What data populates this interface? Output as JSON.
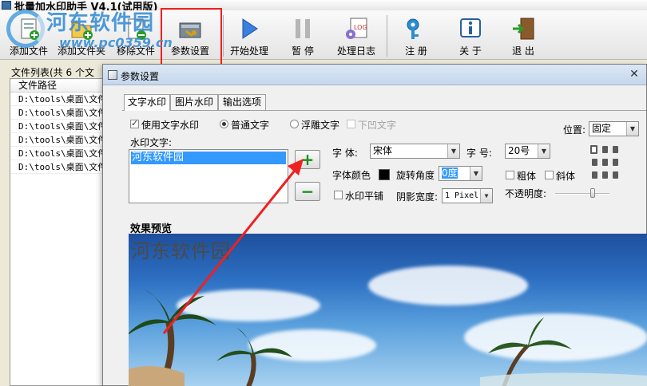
{
  "window": {
    "title": "批量加水印助手 V4.1(试用版)"
  },
  "watermark_logo": {
    "title": "河东软件园",
    "url": "www.pc0359.cn"
  },
  "toolbar": [
    {
      "key": "add_file",
      "label": "添加文件",
      "icon": "add-file-icon"
    },
    {
      "key": "add_folder",
      "label": "添加文件夹",
      "icon": "add-folder-icon"
    },
    {
      "key": "remove_file",
      "label": "移除文件",
      "icon": "remove-file-icon"
    },
    {
      "key": "settings",
      "label": "参数设置",
      "icon": "settings-icon"
    },
    {
      "key": "start",
      "label": "开始处理",
      "icon": "play-icon"
    },
    {
      "key": "pause",
      "label": "暂 停",
      "icon": "pause-icon"
    },
    {
      "key": "log",
      "label": "处理日志",
      "icon": "log-icon"
    },
    {
      "key": "register",
      "label": "注 册",
      "icon": "key-icon"
    },
    {
      "key": "about",
      "label": "关 于",
      "icon": "info-icon"
    },
    {
      "key": "exit",
      "label": "退 出",
      "icon": "exit-door-icon"
    }
  ],
  "file_panel": {
    "group_title": "文件列表(共 6 个文",
    "column_header": "文件路径",
    "rows": [
      "D:\\tools\\桌面\\文件",
      "D:\\tools\\桌面\\文件",
      "D:\\tools\\桌面\\文件",
      "D:\\tools\\桌面\\文件",
      "D:\\tools\\桌面\\文件",
      "D:\\tools\\桌面\\文件"
    ]
  },
  "dialog": {
    "title": "参数设置",
    "close_glyph": "✕",
    "tabs": [
      "文字水印",
      "图片水印",
      "输出选项"
    ],
    "use_text_watermark": {
      "label": "使用文字水印",
      "checked": true
    },
    "text_style": {
      "normal": {
        "label": "普通文字",
        "selected": true
      },
      "embossed": {
        "label": "浮雕文字",
        "selected": false
      },
      "engraved": {
        "label": "下凹文字",
        "checked": false,
        "disabled": true
      }
    },
    "position": {
      "label": "位置:",
      "value": "固定"
    },
    "watermark_text_label": "水印文字:",
    "watermark_text_value": "河东软件园",
    "add_glyph": "+",
    "remove_glyph": "−",
    "font": {
      "label": "字  体:",
      "value": "宋体"
    },
    "font_size": {
      "label": "字  号:",
      "value": "20号"
    },
    "font_color_label": "字体颜色",
    "font_color": "#000000",
    "rotation": {
      "label": "旋转角度",
      "value": "0度"
    },
    "bold": {
      "label": "粗体",
      "checked": false
    },
    "italic": {
      "label": "斜体",
      "checked": false
    },
    "tile": {
      "label": "水印平铺",
      "checked": false
    },
    "shadow_width": {
      "label": "阴影宽度:",
      "value": "1 Pixel"
    },
    "opacity": {
      "label": "不透明度:",
      "value": 0.65
    },
    "preview_label": "效果预览",
    "preview_watermark": "河东软件园"
  },
  "colors": {
    "highlight_box": "#f02020",
    "annotation_arrow": "#f02020",
    "selection": "#3399ff"
  }
}
